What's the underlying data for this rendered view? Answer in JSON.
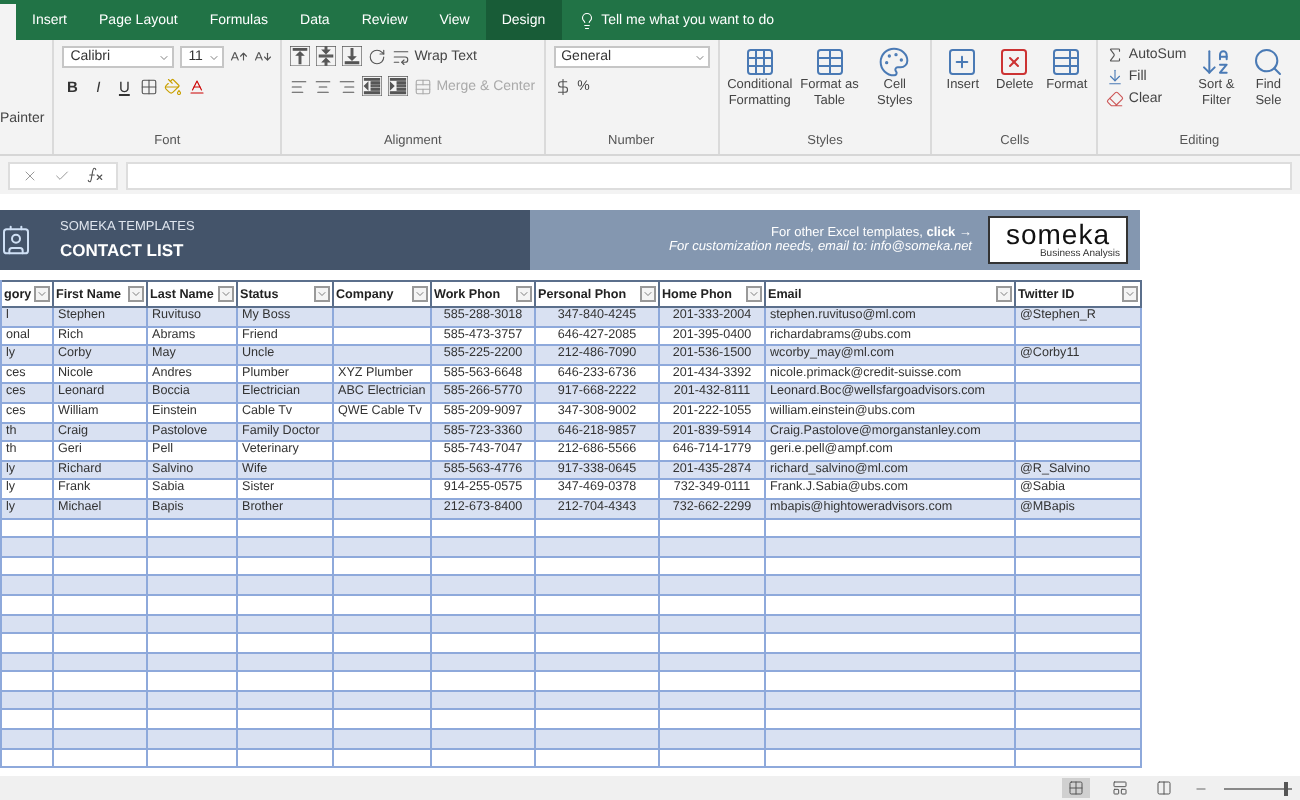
{
  "ribbon_tabs": [
    {
      "label": "Insert",
      "contextual": false
    },
    {
      "label": "Page Layout",
      "contextual": false
    },
    {
      "label": "Formulas",
      "contextual": false
    },
    {
      "label": "Data",
      "contextual": false
    },
    {
      "label": "Review",
      "contextual": false
    },
    {
      "label": "View",
      "contextual": false
    },
    {
      "label": "Design",
      "contextual": true
    }
  ],
  "tell_me": "Tell me what you want to do",
  "clipboard": {
    "format_painter": "Painter"
  },
  "font_group": {
    "font_name": "Calibri",
    "font_size": "11",
    "styles": [
      "B",
      "I",
      "U"
    ],
    "label": "Font"
  },
  "alignment_group": {
    "wrap_text": "Wrap Text",
    "merge": "Merge & Center",
    "label": "Alignment"
  },
  "number_group": {
    "format": "General",
    "percent": "%",
    "label": "Number"
  },
  "styles_group": {
    "buttons": [
      {
        "lines": [
          "Conditional",
          "Formatting"
        ]
      },
      {
        "lines": [
          "Format as",
          "Table"
        ]
      },
      {
        "lines": [
          "Cell",
          "Styles"
        ]
      }
    ],
    "label": "Styles"
  },
  "cells_group": {
    "buttons": [
      "Insert",
      "Delete",
      "Format"
    ],
    "label": "Cells"
  },
  "editing_group": {
    "autosum": "AutoSum",
    "fill": "Fill",
    "clear": "Clear",
    "buttons": [
      {
        "lines": [
          "Sort &",
          "Filter"
        ]
      },
      {
        "lines": [
          "Find",
          "Sele"
        ]
      }
    ],
    "label": "Editing"
  },
  "banner": {
    "brand": "SOMEKA TEMPLATES",
    "title": "CONTACT LIST",
    "note": "For other Excel templates, **click** →",
    "note_2": "For customization needs, email to: info@someka.net",
    "logo": "someka",
    "logo_tagline": "Business Analysis"
  },
  "table": {
    "columns": [
      "gory",
      "First Name",
      "Last Name",
      "Status",
      "Company",
      "Work Phon",
      "Personal Phon",
      "Home Phon",
      "Email",
      "Twitter ID"
    ],
    "rows": [
      [
        "l",
        "Stephen",
        "Ruvituso",
        "My Boss",
        "",
        "585-288-3018",
        "347-840-4245",
        "201-333-2004",
        "stephen.ruvituso@ml.com",
        "@Stephen_R"
      ],
      [
        "onal",
        "Rich",
        "Abrams",
        "Friend",
        "",
        "585-473-3757",
        "646-427-2085",
        "201-395-0400",
        "richardabrams@ubs.com",
        ""
      ],
      [
        "ly",
        "Corby",
        "May",
        "Uncle",
        "",
        "585-225-2200",
        "212-486-7090",
        "201-536-1500",
        "wcorby_may@ml.com",
        "@Corby11"
      ],
      [
        "ces",
        "Nicole",
        "Andres",
        "Plumber",
        "XYZ Plumber",
        "585-563-6648",
        "646-233-6736",
        "201-434-3392",
        "nicole.primack@credit-suisse.com",
        ""
      ],
      [
        "ces",
        "Leonard",
        "Boccia",
        "Electrician",
        "ABC Electrician",
        "585-266-5770",
        "917-668-2222",
        "201-432-8111",
        "Leonard.Boc@wellsfargoadvisors.com",
        ""
      ],
      [
        "ces",
        "William",
        "Einstein",
        "Cable Tv",
        "QWE Cable Tv",
        "585-209-9097",
        "347-308-9002",
        "201-222-1055",
        "william.einstein@ubs.com",
        ""
      ],
      [
        "th",
        "Craig",
        "Pastolove",
        "Family Doctor",
        "",
        "585-723-3360",
        "646-218-9857",
        "201-839-5914",
        "Craig.Pastolove@morganstanley.com",
        ""
      ],
      [
        "th",
        "Geri",
        "Pell",
        "Veterinary",
        "",
        "585-743-7047",
        "212-686-5566",
        "646-714-1779",
        "geri.e.pell@ampf.com",
        ""
      ],
      [
        "ly",
        "Richard",
        "Salvino",
        "Wife",
        "",
        "585-563-4776",
        "917-338-0645",
        "201-435-2874",
        "richard_salvino@ml.com",
        "@R_Salvino"
      ],
      [
        "ly",
        "Frank",
        "Sabia",
        "Sister",
        "",
        "914-255-0575",
        "347-469-0378",
        "732-349-0111",
        "Frank.J.Sabia@ubs.com",
        "@Sabia"
      ],
      [
        "ly",
        "Michael",
        "Bapis",
        "Brother",
        "",
        "212-673-8400",
        "212-704-4343",
        "732-662-2299",
        "mbapis@hightoweradvisors.com",
        "@MBapis"
      ]
    ]
  },
  "status_bar": {
    "zoom_slider": {
      "level": 0.9
    }
  }
}
